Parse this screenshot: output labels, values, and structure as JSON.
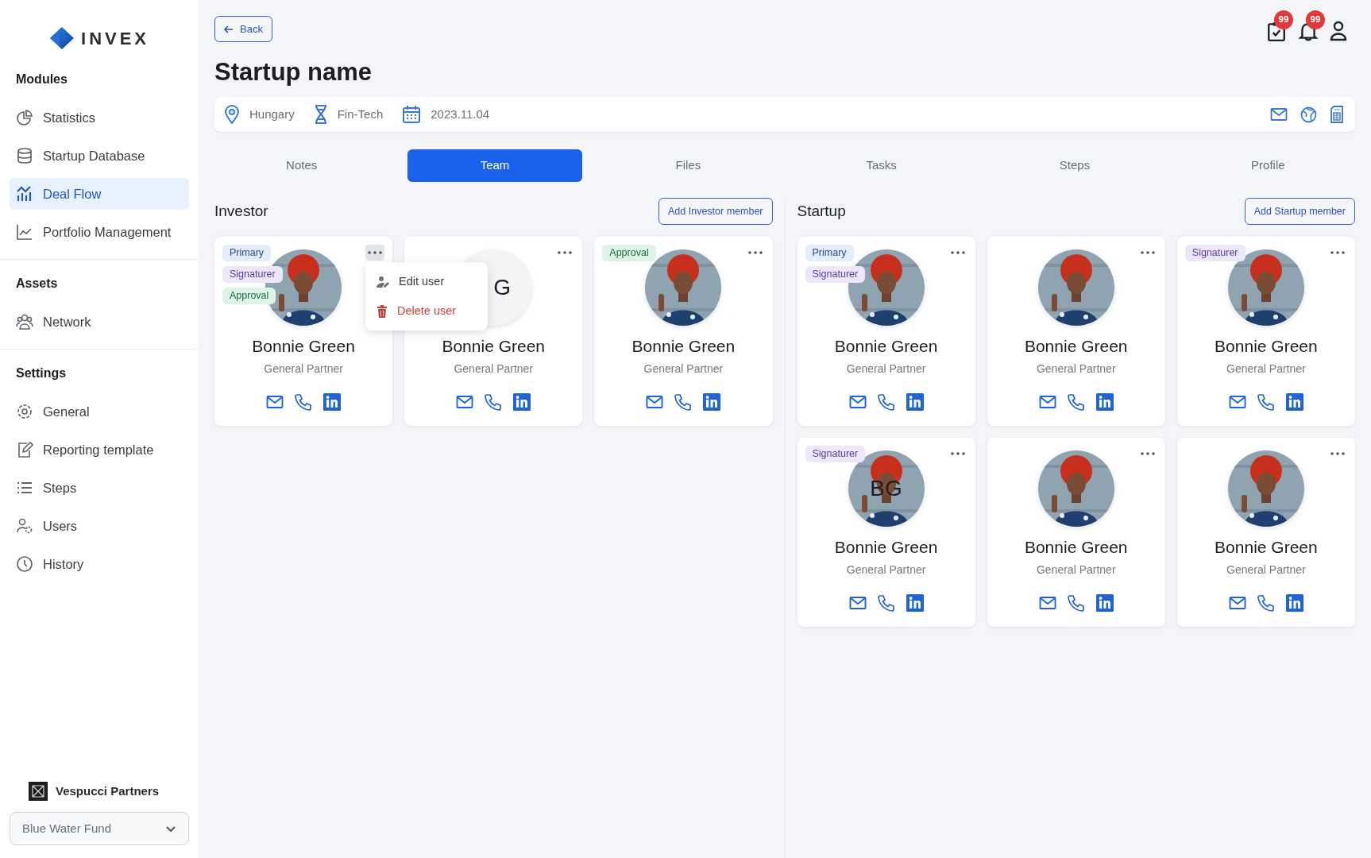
{
  "logo": {
    "text": "INVEX"
  },
  "sidebar": {
    "sections": [
      {
        "title": "Modules",
        "items": [
          {
            "label": "Statistics",
            "selected": false
          },
          {
            "label": "Startup Database",
            "selected": false
          },
          {
            "label": "Deal Flow",
            "selected": true
          },
          {
            "label": "Portfolio Management",
            "selected": false
          }
        ]
      },
      {
        "title": "Assets",
        "items": [
          {
            "label": "Network",
            "selected": false
          }
        ]
      },
      {
        "title": "Settings",
        "items": [
          {
            "label": "General",
            "selected": false
          },
          {
            "label": "Reporting template",
            "selected": false
          },
          {
            "label": "Steps",
            "selected": false
          },
          {
            "label": "Users",
            "selected": false
          },
          {
            "label": "History",
            "selected": false
          }
        ]
      }
    ]
  },
  "organization": {
    "name": "Vespucci Partners"
  },
  "fund_select": {
    "value": "Blue Water Fund"
  },
  "back_button": "Back",
  "header_counts": [
    "99",
    "99"
  ],
  "title": "Startup name",
  "info_bar": [
    "Hungary",
    "Fin-Tech",
    "2023.11.04"
  ],
  "tabs": [
    {
      "label": "Notes",
      "selected": false
    },
    {
      "label": "Team",
      "selected": true
    },
    {
      "label": "Files",
      "selected": false
    },
    {
      "label": "Tasks",
      "selected": false
    },
    {
      "label": "Steps",
      "selected": false
    },
    {
      "label": "Profile",
      "selected": false
    }
  ],
  "groups": [
    {
      "title": "Investor",
      "add_button": "Add Investor member",
      "members": [
        {
          "name": "Bonnie Green",
          "role": "General Partner",
          "tags": [
            {
              "label": "Primary",
              "kind": "primary"
            },
            {
              "label": "Signaturer",
              "kind": "signaturer"
            },
            {
              "label": "Approval",
              "kind": "approval"
            }
          ],
          "avatar": {
            "kind": "picture"
          },
          "menu_open": true
        },
        {
          "name": "Bonnie Green",
          "role": "General Partner",
          "avatar": {
            "kind": "initials",
            "text": "G"
          },
          "menu_open": false
        },
        {
          "name": "Bonnie Green",
          "role": "General Partner",
          "tags": [
            {
              "label": "Approval",
              "kind": "approval"
            }
          ],
          "avatar": {
            "kind": "picture"
          },
          "menu_open": false
        }
      ]
    },
    {
      "title": "Startup",
      "add_button": "Add Startup member",
      "members": [
        {
          "name": "Bonnie Green",
          "role": "General Partner",
          "tags": [
            {
              "label": "Primary",
              "kind": "primary"
            },
            {
              "label": "Signaturer",
              "kind": "signaturer"
            }
          ],
          "avatar": {
            "kind": "picture"
          },
          "menu_open": false
        },
        {
          "name": "Bonnie Green",
          "role": "General Partner",
          "avatar": {
            "kind": "picture"
          },
          "menu_open": false
        },
        {
          "name": "Bonnie Green",
          "role": "General Partner",
          "tags": [
            {
              "label": "Signaturer",
              "kind": "signaturer"
            }
          ],
          "avatar": {
            "kind": "picture"
          },
          "menu_open": false
        },
        {
          "name": "Bonnie Green",
          "role": "General Partner",
          "tags": [
            {
              "label": "Signaturer",
              "kind": "signaturer"
            }
          ],
          "avatar": {
            "kind": "picture",
            "text": "BG"
          },
          "menu_open": false
        },
        {
          "name": "Bonnie Green",
          "role": "General Partner",
          "avatar": {
            "kind": "picture"
          },
          "menu_open": false
        },
        {
          "name": "Bonnie Green",
          "role": "General Partner",
          "avatar": {
            "kind": "picture"
          },
          "menu_open": false
        }
      ]
    }
  ],
  "member_menu": [
    {
      "label": "Edit user",
      "kind": "edit"
    },
    {
      "label": "Delete user",
      "kind": "delete"
    }
  ]
}
